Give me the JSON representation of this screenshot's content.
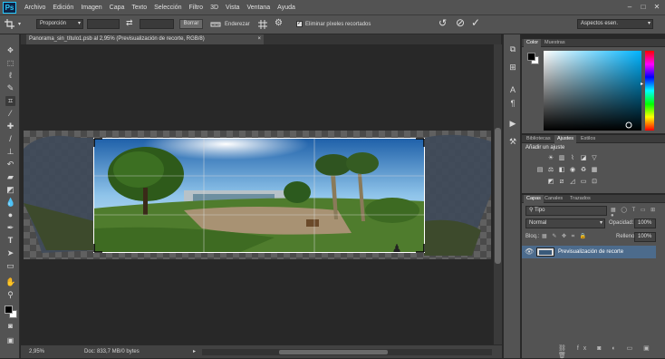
{
  "app": {
    "logo": "Ps"
  },
  "menu": [
    "Archivo",
    "Edición",
    "Imagen",
    "Capa",
    "Texto",
    "Selección",
    "Filtro",
    "3D",
    "Vista",
    "Ventana",
    "Ayuda"
  ],
  "window_controls": {
    "minimize": "–",
    "restore": "□",
    "close": "✕"
  },
  "options": {
    "crop_icon": "crop-icon",
    "ratio_value": "Proporción",
    "swap_icon": "⇄",
    "clear_label": "Borrar",
    "straighten_label": "Enderezar",
    "delete_cropped_label": "Eliminar píxeles recortados",
    "workspace_value": "Aspectos esen."
  },
  "document": {
    "tab_title": "Panorama_sin_título1.psb al 2,95% (Previsualización de recorte, RGB/8)",
    "tab_close": "×"
  },
  "status": {
    "zoom": "2,95%",
    "doc_info": "Doc: 833,7 MB/0 bytes"
  },
  "color_panel": {
    "tabs": [
      "Color",
      "Muestras"
    ]
  },
  "adjust_panel": {
    "tabs": [
      "Bibliotecas",
      "Ajustes",
      "Estilos"
    ],
    "heading": "Añadir un ajuste"
  },
  "layers_panel": {
    "tabs": [
      "Capas",
      "Canales",
      "Trazados"
    ],
    "filter_value": "Tipo",
    "blend_mode": "Normal",
    "opacity_label": "Opacidad:",
    "opacity_value": "100%",
    "lock_label": "Bloq.:",
    "fill_label": "Relleno:",
    "fill_value": "100%",
    "layer_name": "Previsualización de recorte"
  },
  "colors": {
    "accent": "#4c6b8c",
    "photoshop_blue": "#31c5f0"
  }
}
